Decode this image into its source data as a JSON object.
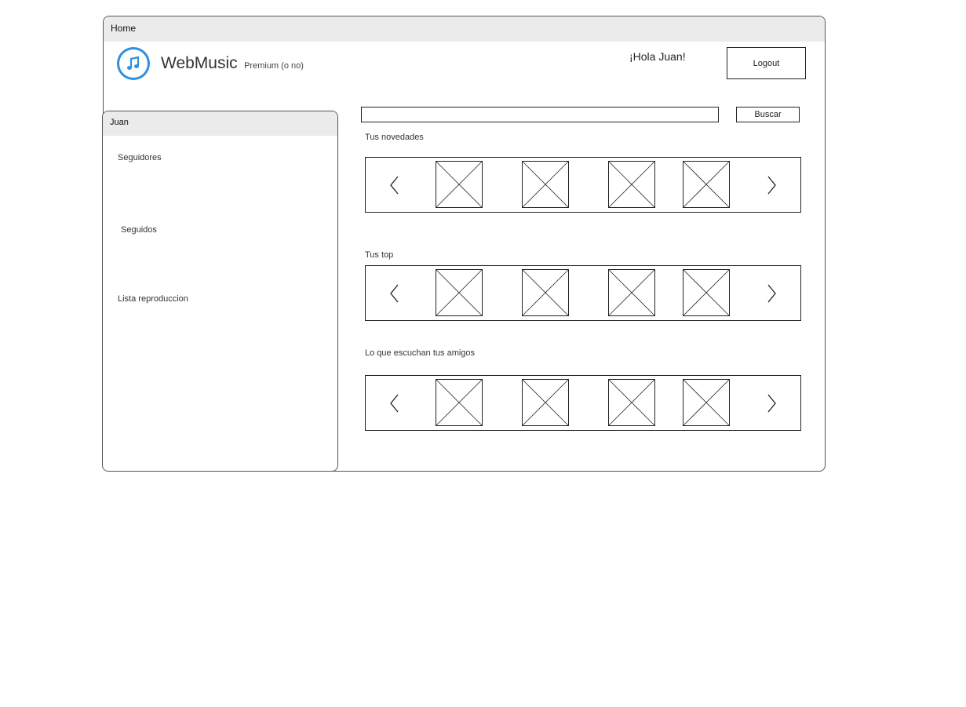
{
  "window": {
    "title": "Home"
  },
  "header": {
    "app_name": "WebMusic",
    "tier_label": "Premium (o no)",
    "greeting": "¡Hola Juan!",
    "logout_label": "Logout"
  },
  "sidebar": {
    "user_name": "Juan",
    "items": [
      {
        "label": "Seguidores"
      },
      {
        "label": "Seguidos"
      },
      {
        "label": "Lista reproduccion"
      }
    ]
  },
  "search": {
    "value": "",
    "placeholder": "",
    "button_label": "Buscar"
  },
  "sections": [
    {
      "title": "Tus novedades"
    },
    {
      "title": "Tus top"
    },
    {
      "title": "Lo que escuchan tus amigos"
    }
  ],
  "icons": {
    "logo": "music-note-icon",
    "carousel_prev": "chevron-left-icon",
    "carousel_next": "chevron-right-icon",
    "thumbnail": "image-placeholder-icon"
  },
  "colors": {
    "accent": "#2f8fe0",
    "header_bg": "#ebebeb"
  }
}
